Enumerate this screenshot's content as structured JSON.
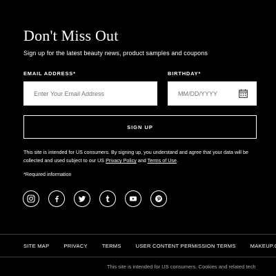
{
  "newsletter": {
    "title": "Don't Miss Out",
    "subtitle": "Sign up for the latest beauty news, product samples and coupons",
    "email_label": "EMAIL ADDRESS*",
    "email_placeholder": "Enter Your Email Address",
    "birthday_label": "BIRTHDAY*",
    "birthday_placeholder": "MM/DD/YYYY",
    "signup_label": "SIGN UP",
    "legal_text_1": "This site is intended for US consumers. By signing up, you understand and agree that your data will be collected and used subject to our US ",
    "privacy_link": "Privacy Policy",
    "legal_and": " and ",
    "terms_link": "Terms of Use",
    "legal_end": ".",
    "required_note": "*Required information"
  },
  "socials": [
    {
      "name": "instagram-icon"
    },
    {
      "name": "facebook-icon"
    },
    {
      "name": "twitter-icon"
    },
    {
      "name": "tumblr-icon"
    },
    {
      "name": "youtube-icon"
    },
    {
      "name": "pinterest-icon"
    }
  ],
  "footer": {
    "links": [
      "SITE MAP",
      "PRIVACY",
      "TERMS",
      "USER CONTENT PERMISSION TERMS",
      "MAKEUP.COM"
    ],
    "note": "This site is intended for US consumers. Cookies and related tech"
  }
}
